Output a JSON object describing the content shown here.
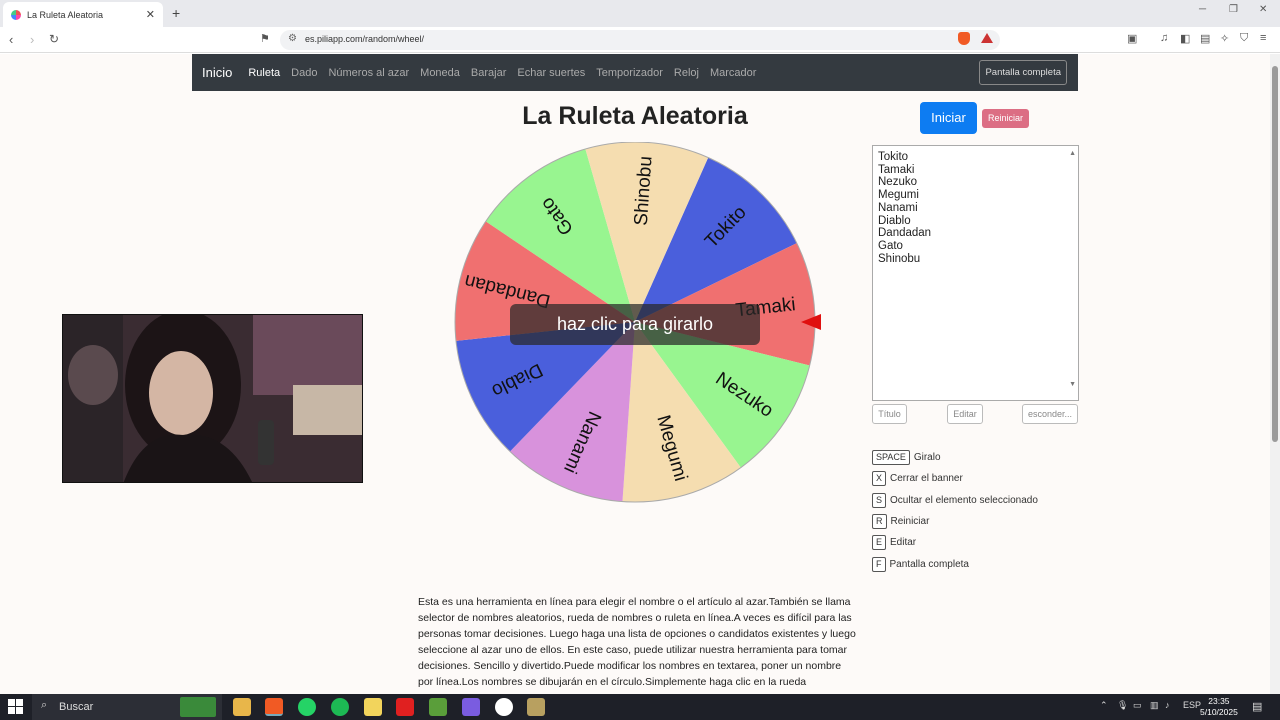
{
  "browser": {
    "tab_title": "La Ruleta Aleatoria",
    "new_tab": "+",
    "url": "es.piliapp.com/random/wheel/"
  },
  "site_nav": {
    "brand": "Inicio",
    "links": [
      "Ruleta",
      "Dado",
      "Números al azar",
      "Moneda",
      "Barajar",
      "Echar suertes",
      "Temporizador",
      "Reloj",
      "Marcador"
    ],
    "fullscreen_label": "Pantalla completa"
  },
  "main": {
    "title": "La Ruleta Aleatoria",
    "start_label": "Iniciar",
    "reset_label": "Reiniciar",
    "spin_prompt": "haz clic para girarlo"
  },
  "wheel": {
    "segments": [
      {
        "label": "Tokito",
        "color": "#4a5fdc"
      },
      {
        "label": "Tamaki",
        "color": "#f07070"
      },
      {
        "label": "Nezuko",
        "color": "#98f590"
      },
      {
        "label": "Megumi",
        "color": "#f5ddb0"
      },
      {
        "label": "Nanami",
        "color": "#d892dc"
      },
      {
        "label": "Diablo",
        "color": "#4a5fdc"
      },
      {
        "label": "Dandadan",
        "color": "#f07070"
      },
      {
        "label": "Gato",
        "color": "#98f590"
      },
      {
        "label": "Shinobu",
        "color": "#f5ddb0"
      }
    ],
    "pointer_color": "#e01010"
  },
  "names_list": [
    "Tokito",
    "Tamaki",
    "Nezuko",
    "Megumi",
    "Nanami",
    "Diablo",
    "Dandadan",
    "Gato",
    "Shinobu"
  ],
  "list_buttons": {
    "title_label": "Título",
    "edit_label": "Editar",
    "hide_label": "esconder..."
  },
  "shortcuts": [
    {
      "key": "SPACE",
      "text": "Giralo"
    },
    {
      "key": "X",
      "text": "Cerrar el banner"
    },
    {
      "key": "S",
      "text": "Ocultar el elemento seleccionado"
    },
    {
      "key": "R",
      "text": "Reiniciar"
    },
    {
      "key": "E",
      "text": "Editar"
    },
    {
      "key": "F",
      "text": "Pantalla completa"
    }
  ],
  "description": "Esta es una herramienta en línea para elegir el nombre o el artículo al azar.También se llama selector de nombres aleatorios, rueda de nombres o ruleta en línea.A veces es difícil para las personas tomar decisiones. Luego haga una lista de opciones o candidatos existentes y luego seleccione al azar uno de ellos. En este caso, puede utilizar nuestra herramienta para tomar decisiones. Sencillo y divertido.Puede modificar los nombres en textarea, poner un nombre por línea.Los nombres se dibujarán en el círculo.Simplemente haga clic en la rueda",
  "taskbar": {
    "search_label": "Buscar",
    "lang": "ESP",
    "time": "23:35",
    "date": "5/10/2025"
  }
}
